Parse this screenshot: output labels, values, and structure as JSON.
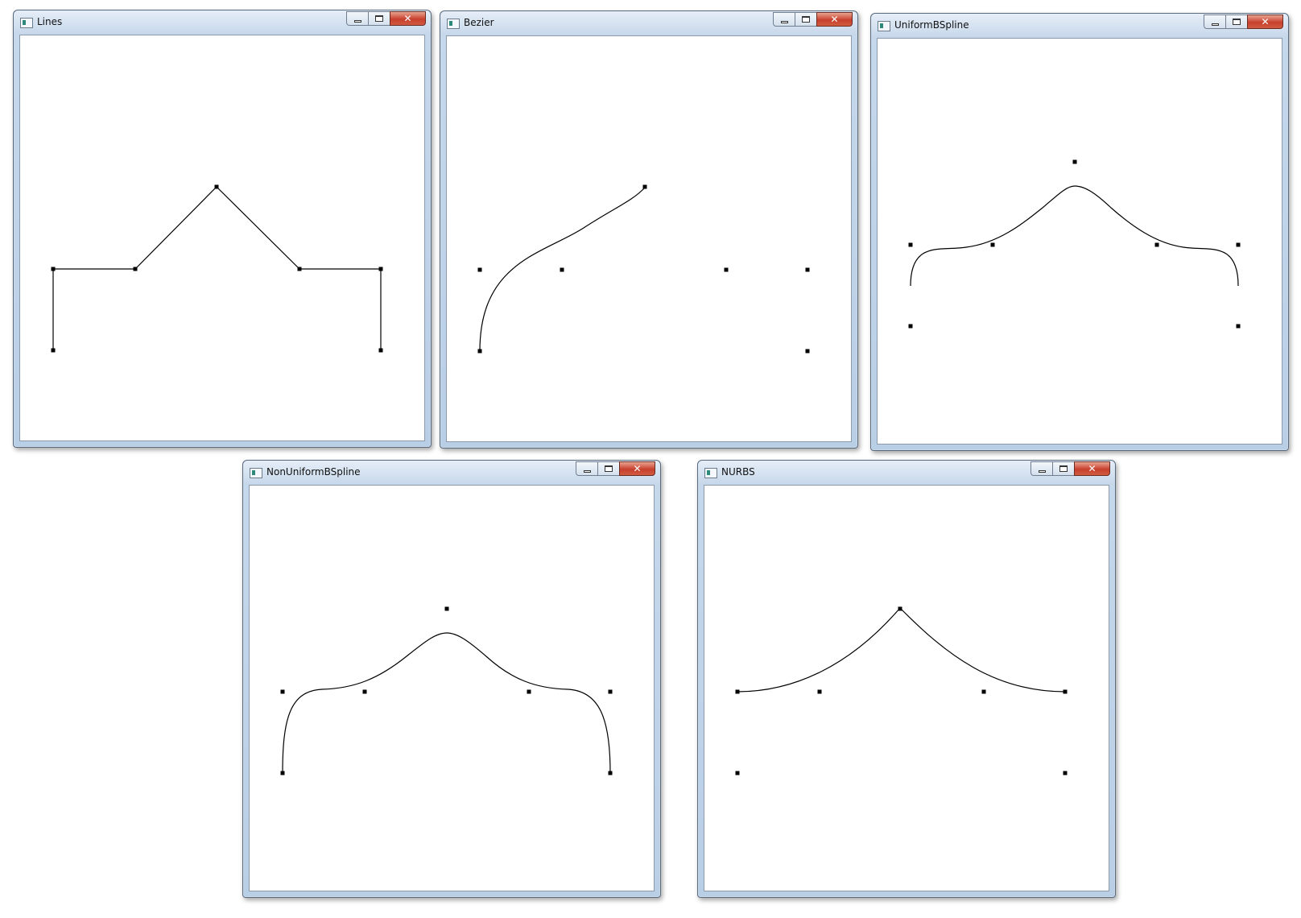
{
  "windows": [
    {
      "id": "lines",
      "title": "Lines",
      "controls": {
        "minimize": "minimize-icon",
        "maximize": "maximize-icon",
        "close": "close-icon"
      },
      "curve": "polyline"
    },
    {
      "id": "bezier",
      "title": "Bezier",
      "controls": {
        "minimize": "minimize-icon",
        "maximize": "maximize-icon",
        "close": "close-icon"
      },
      "curve": "bezier"
    },
    {
      "id": "uniform-bspline",
      "title": "UniformBSpline",
      "controls": {
        "minimize": "minimize-icon",
        "maximize": "maximize-icon",
        "close": "close-icon"
      },
      "curve": "uniform-bspline"
    },
    {
      "id": "non-uniform-bspline",
      "title": "NonUniformBSpline",
      "controls": {
        "minimize": "minimize-icon",
        "maximize": "maximize-icon",
        "close": "close-icon"
      },
      "curve": "non-uniform-bspline"
    },
    {
      "id": "nurbs",
      "title": "NURBS",
      "controls": {
        "minimize": "minimize-icon",
        "maximize": "maximize-icon",
        "close": "close-icon"
      },
      "curve": "nurbs"
    }
  ],
  "colors": {
    "curve": "#000000",
    "control_point": "#000000",
    "client_bg": "#ffffff"
  }
}
